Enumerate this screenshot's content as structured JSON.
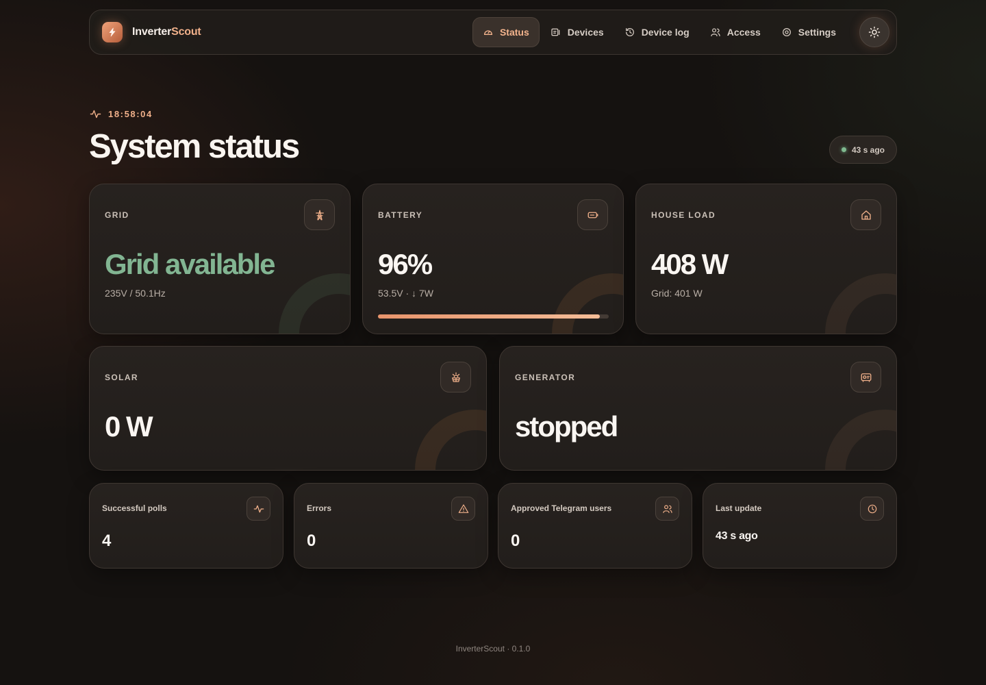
{
  "header": {
    "brand_main": "Inverter",
    "brand_accent": "Scout",
    "nav": {
      "status": "Status",
      "devices": "Devices",
      "device_log": "Device log",
      "access": "Access",
      "settings": "Settings"
    },
    "active_nav": "status",
    "theme_toggle_icon": "sun-icon"
  },
  "page": {
    "clock": "18:58:04",
    "title": "System status",
    "last_seen": "43 s ago"
  },
  "cards": {
    "grid": {
      "label": "GRID",
      "value": "Grid available",
      "sub": "235V / 50.1Hz",
      "icon": "power-tower-icon"
    },
    "battery": {
      "label": "BATTERY",
      "value": "96%",
      "sub": "53.5V · ↓ 7W",
      "level_percent": 96,
      "icon": "battery-icon"
    },
    "house_load": {
      "label": "HOUSE LOAD",
      "value": "408 W",
      "sub": "Grid: 401 W",
      "icon": "home-icon"
    },
    "solar": {
      "label": "SOLAR",
      "value": "0 W",
      "icon": "solar-panel-icon"
    },
    "generator": {
      "label": "GENERATOR",
      "value": "stopped",
      "icon": "generator-icon"
    }
  },
  "stats": {
    "polls": {
      "label": "Successful polls",
      "value": "4",
      "icon": "pulse-icon"
    },
    "errors": {
      "label": "Errors",
      "value": "0",
      "icon": "warning-icon"
    },
    "users": {
      "label": "Approved Telegram users",
      "value": "0",
      "icon": "users-icon"
    },
    "last_update": {
      "label": "Last update",
      "value": "43 s ago",
      "icon": "clock-icon"
    }
  },
  "footer": {
    "text": "InverterScout · 0.1.0"
  },
  "colors": {
    "accent": "#f0b08a",
    "grid_ok": "#82b592",
    "background": "#151210",
    "card": "#24201d"
  }
}
